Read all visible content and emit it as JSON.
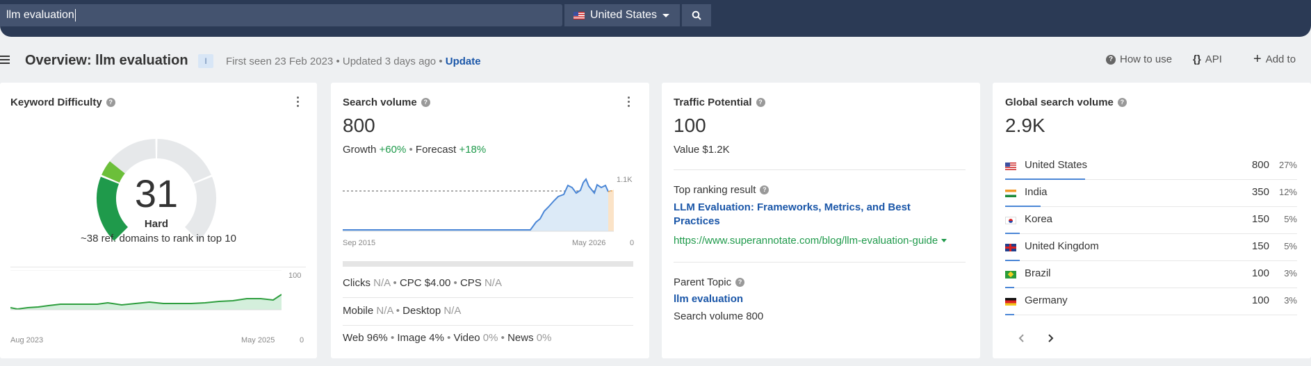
{
  "search": {
    "query": "llm evaluation",
    "country": "United States"
  },
  "header": {
    "title": "Overview: llm evaluation",
    "badge": "I",
    "first_seen": "First seen 23 Feb 2023",
    "updated": "Updated 3 days ago",
    "update_link": "Update",
    "how_to_use": "How to use",
    "api": "API",
    "add_to": "Add to"
  },
  "kd": {
    "title": "Keyword Difficulty",
    "score": "31",
    "score_value": 31,
    "label": "Hard",
    "note": "~38 ref. domains to rank in top 10",
    "axis_start": "Aug 2023",
    "axis_end": "May 2025",
    "y_max": "100",
    "y_min": "0"
  },
  "sv": {
    "title": "Search volume",
    "value": "800",
    "growth_label": "Growth",
    "growth": "+60%",
    "forecast_label": "Forecast",
    "forecast": "+18%",
    "axis_start": "Sep 2015",
    "axis_end": "May 2026",
    "y_max": "1.1K",
    "y_min": "0",
    "clicks_label": "Clicks",
    "clicks": "N/A",
    "cpc_label": "CPC",
    "cpc": "$4.00",
    "cps_label": "CPS",
    "cps": "N/A",
    "mobile_label": "Mobile",
    "mobile": "N/A",
    "desktop_label": "Desktop",
    "desktop": "N/A",
    "web_label": "Web",
    "web": "96%",
    "image_label": "Image",
    "image": "4%",
    "video_label": "Video",
    "video": "0%",
    "news_label": "News",
    "news": "0%"
  },
  "tp": {
    "title": "Traffic Potential",
    "value": "100",
    "value_line": "Value $1.2K",
    "top_result_label": "Top ranking result",
    "top_result_title": "LLM Evaluation: Frameworks, Metrics, and Best Practices",
    "top_result_url": "https://www.superannotate.com/blog/llm-evaluation-guide",
    "parent_topic_label": "Parent Topic",
    "parent_topic": "llm evaluation",
    "parent_volume": "Search volume 800"
  },
  "gsv": {
    "title": "Global search volume",
    "value": "2.9K",
    "countries": [
      {
        "name": "United States",
        "flag": "us",
        "volume": "800",
        "pct": "27%",
        "share": 27
      },
      {
        "name": "India",
        "flag": "in",
        "volume": "350",
        "pct": "12%",
        "share": 12
      },
      {
        "name": "Korea",
        "flag": "kr",
        "volume": "150",
        "pct": "5%",
        "share": 5
      },
      {
        "name": "United Kingdom",
        "flag": "uk",
        "volume": "150",
        "pct": "5%",
        "share": 5
      },
      {
        "name": "Brazil",
        "flag": "br",
        "volume": "100",
        "pct": "3%",
        "share": 3
      },
      {
        "name": "Germany",
        "flag": "de",
        "volume": "100",
        "pct": "3%",
        "share": 3
      }
    ]
  },
  "colors": {
    "topbar": "#2b3a55",
    "accent_blue": "#1a56a8",
    "positive_green": "#1f9a4b",
    "kd_green": "#2e9e3e",
    "gauge_track": "#e6e8ea",
    "sv_line": "#4a86d6",
    "forecast": "#f0a040"
  },
  "icons": {
    "search_button": "search-icon",
    "menu": "hamburger-icon",
    "help": "question-circle-icon",
    "api": "braces-icon",
    "add": "plus-icon",
    "more": "kebab-icon",
    "prev": "chevron-left-icon",
    "next": "chevron-right-icon"
  }
}
